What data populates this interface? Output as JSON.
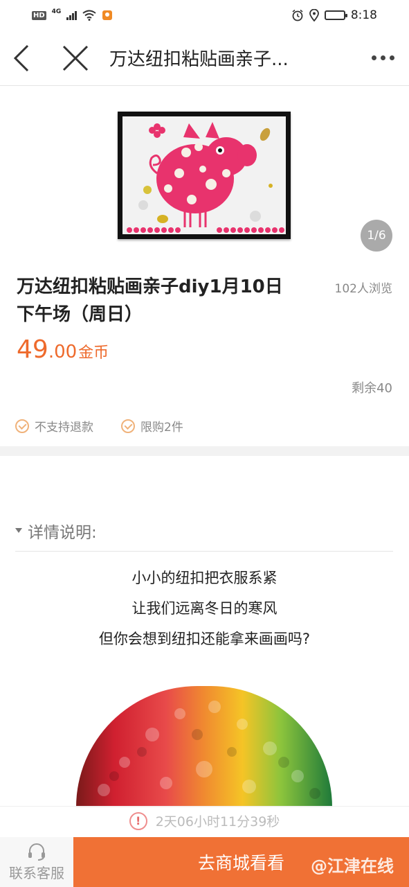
{
  "status_bar": {
    "hd": "HD",
    "network": "4G",
    "time": "8:18"
  },
  "nav": {
    "title": "万达纽扣粘贴画亲子..."
  },
  "gallery": {
    "pager": "1/6"
  },
  "product": {
    "title": "万达纽扣粘贴画亲子diy1月10日下午场（周日）",
    "views": "102人浏览",
    "price_int": "49",
    "price_dec": ".00",
    "price_unit": "金币",
    "remaining": "剩余40",
    "tags": [
      "不支持退款",
      "限购2件"
    ]
  },
  "details": {
    "label": "详情说明:",
    "lines": [
      "小小的纽扣把衣服系紧",
      "让我们远离冬日的寒风",
      "但你会想到纽扣还能拿来画画吗?"
    ]
  },
  "countdown": {
    "text": "2天06小时11分39秒"
  },
  "bottom": {
    "service_label": "联系客服",
    "shop_label": "去商城看看",
    "watermark": "@江津在线"
  },
  "colors": {
    "accent": "#f07135",
    "price": "#ee6a2c",
    "pig": "#e8336d"
  }
}
